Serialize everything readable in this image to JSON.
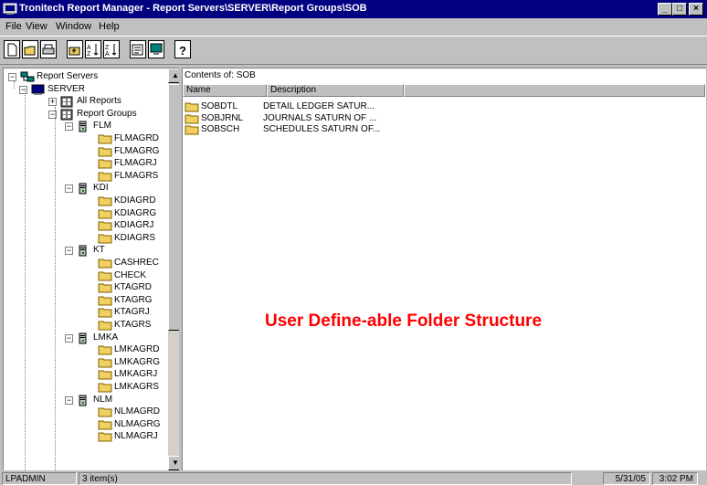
{
  "window": {
    "title": "Tronitech Report Manager - Report Servers\\SERVER\\Report Groups\\SOB",
    "minimize": "_",
    "maximize": "□",
    "close": "×"
  },
  "menu": [
    "File",
    "View",
    "Window",
    "Help"
  ],
  "tree": {
    "root": "Report Servers",
    "server": "SERVER",
    "all_reports": "All Reports",
    "report_groups": "Report Groups",
    "groups": [
      {
        "name": "FLM",
        "items": [
          "FLMAGRD",
          "FLMAGRG",
          "FLMAGRJ",
          "FLMAGRS"
        ]
      },
      {
        "name": "KDI",
        "items": [
          "KDIAGRD",
          "KDIAGRG",
          "KDIAGRJ",
          "KDIAGRS"
        ]
      },
      {
        "name": "KT",
        "items": [
          "CASHREC",
          "CHECK",
          "KTAGRD",
          "KTAGRG",
          "KTAGRJ",
          "KTAGRS"
        ]
      },
      {
        "name": "LMKA",
        "items": [
          "LMKAGRD",
          "LMKAGRG",
          "LMKAGRJ",
          "LMKAGRS"
        ]
      },
      {
        "name": "NLM",
        "items": [
          "NLMAGRD",
          "NLMAGRG",
          "NLMAGRJ"
        ]
      }
    ]
  },
  "contents": {
    "label": "Contents of: SOB",
    "columns": [
      "Name",
      "Description"
    ],
    "rows": [
      {
        "name": "SOBDTL",
        "description": "DETAIL LEDGER SATUR..."
      },
      {
        "name": "SOBJRNL",
        "description": "JOURNALS SATURN OF ..."
      },
      {
        "name": "SOBSCH",
        "description": "SCHEDULES SATURN OF..."
      }
    ]
  },
  "overlay": "User Define-able Folder Structure",
  "status": {
    "user": "LPADMIN",
    "items": "3 item(s)",
    "date": "5/31/05",
    "time": "3:02 PM"
  },
  "colors": {
    "titlebar": "#000080",
    "folder": "#f0d060",
    "overlay": "#ff0000"
  }
}
